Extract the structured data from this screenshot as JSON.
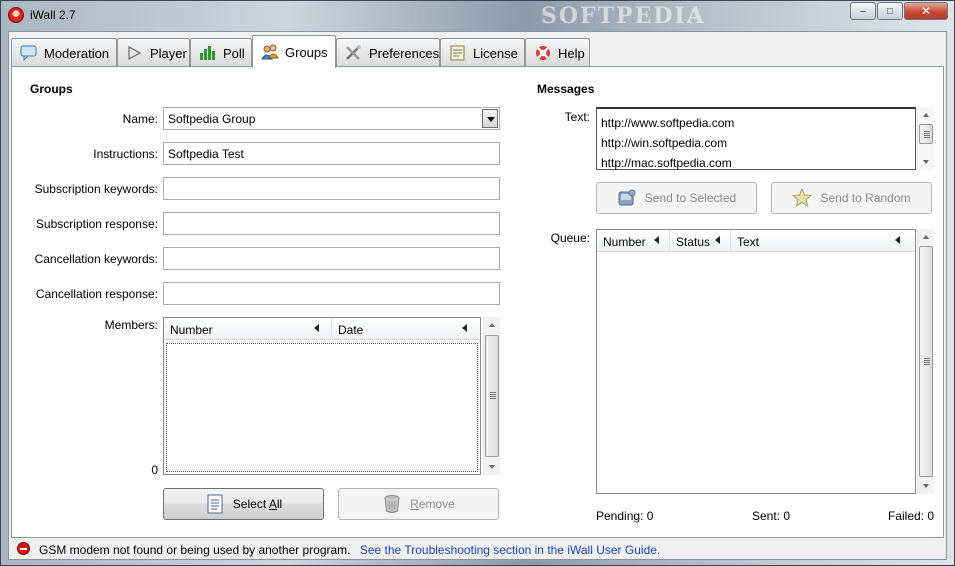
{
  "window": {
    "title": "iWall 2.7",
    "watermark": "SOFTPEDIA",
    "caption_buttons": {
      "minimize": "–",
      "maximize": "□",
      "close": "✕"
    }
  },
  "tabs": [
    {
      "label": "Moderation",
      "icon": "speech-bubble-icon",
      "active": false
    },
    {
      "label": "Player",
      "icon": "play-icon",
      "active": false
    },
    {
      "label": "Poll",
      "icon": "bar-chart-icon",
      "active": false
    },
    {
      "label": "Groups",
      "icon": "group-icon",
      "active": true
    },
    {
      "label": "Preferences",
      "icon": "tools-icon",
      "active": false
    },
    {
      "label": "License",
      "icon": "certificate-icon",
      "active": false
    },
    {
      "label": "Help",
      "icon": "lifebuoy-icon",
      "active": false
    }
  ],
  "groups": {
    "section_title": "Groups",
    "name_label": "Name:",
    "name_value": "Softpedia Group",
    "instructions_label": "Instructions:",
    "instructions_value": "Softpedia Test",
    "sub_keywords_label": "Subscription keywords:",
    "sub_keywords_value": "",
    "sub_response_label": "Subscription response:",
    "sub_response_value": "",
    "cancel_keywords_label": "Cancellation keywords:",
    "cancel_keywords_value": "",
    "cancel_response_label": "Cancellation response:",
    "cancel_response_value": "",
    "members_label": "Members:",
    "members_count": "0",
    "members_columns": [
      "Number",
      "Date"
    ],
    "select_all_button": {
      "before": "Select ",
      "underline": "A",
      "after": "ll"
    },
    "remove_button": {
      "before": "",
      "underline": "R",
      "after": "emove"
    }
  },
  "messages": {
    "section_title": "Messages",
    "text_label": "Text:",
    "text_lines": [
      "http://www.softpedia.com",
      "http://win.softpedia.com",
      "http://mac.softpedia.com"
    ],
    "send_selected_label": "Send to Selected",
    "send_random_label": "Send to Random",
    "queue_label": "Queue:",
    "queue_columns": [
      "Number",
      "Status",
      "Text"
    ],
    "pending_label": "Pending:",
    "pending_value": "0",
    "sent_label": "Sent:",
    "sent_value": "0",
    "failed_label": "Failed:",
    "failed_value": "0"
  },
  "status": {
    "message": "GSM modem not found or being used by another program.",
    "link": "See the Troubleshooting section in the iWall User Guide."
  },
  "colors": {
    "link": "#1a44b8",
    "error": "#d01818",
    "accent_tab": "#ffffff"
  }
}
